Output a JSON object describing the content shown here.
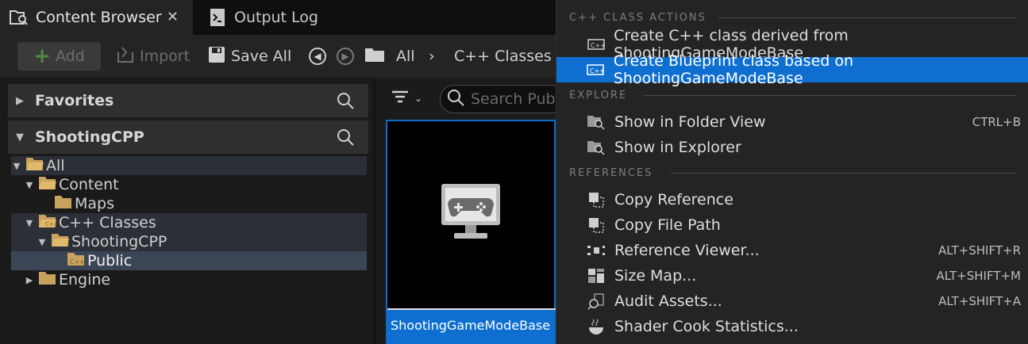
{
  "tabs": [
    {
      "label": "Content Browser",
      "icon": "content-browser-icon",
      "active": true
    },
    {
      "label": "Output Log",
      "icon": "output-log-icon",
      "active": false
    }
  ],
  "toolbar": {
    "add_label": "Add",
    "import_label": "Import",
    "save_all_label": "Save All",
    "breadcrumb": [
      "All",
      "C++ Classes"
    ]
  },
  "sidebar": {
    "favorites_label": "Favorites",
    "project_label": "ShootingCPP",
    "tree": [
      {
        "label": "All",
        "depth": 0,
        "expanded": true
      },
      {
        "label": "Content",
        "depth": 1,
        "expanded": true
      },
      {
        "label": "Maps",
        "depth": 2,
        "expanded": false
      },
      {
        "label": "C++ Classes",
        "depth": 1,
        "expanded": true
      },
      {
        "label": "ShootingCPP",
        "depth": 2,
        "expanded": true
      },
      {
        "label": "Public",
        "depth": 3,
        "selected": true
      },
      {
        "label": "Engine",
        "depth": 1,
        "expanded": false
      }
    ]
  },
  "assets": {
    "search_placeholder": "Search Public",
    "items": [
      {
        "name": "ShootingGameModeBase",
        "icon": "game-mode-icon"
      }
    ]
  },
  "context_menu": {
    "sections": [
      {
        "title": "C++ CLASS ACTIONS",
        "items": [
          {
            "label": "Create C++ class derived from ShootingGameModeBase",
            "icon": "cpp-class-icon",
            "shortcut": ""
          },
          {
            "label": "Create Blueprint class based on ShootingGameModeBase",
            "icon": "cpp-class-icon",
            "shortcut": "",
            "highlighted": true
          }
        ]
      },
      {
        "title": "EXPLORE",
        "items": [
          {
            "label": "Show in Folder View",
            "icon": "folder-search-icon",
            "shortcut": "CTRL+B"
          },
          {
            "label": "Show in Explorer",
            "icon": "folder-search-icon",
            "shortcut": ""
          }
        ]
      },
      {
        "title": "REFERENCES",
        "items": [
          {
            "label": "Copy Reference",
            "icon": "copy-icon",
            "shortcut": ""
          },
          {
            "label": "Copy File Path",
            "icon": "copy-icon",
            "shortcut": ""
          },
          {
            "label": "Reference Viewer...",
            "icon": "reference-viewer-icon",
            "shortcut": "ALT+SHIFT+R"
          },
          {
            "label": "Size Map...",
            "icon": "size-map-icon",
            "shortcut": "ALT+SHIFT+M"
          },
          {
            "label": "Audit Assets...",
            "icon": "audit-icon",
            "shortcut": "ALT+SHIFT+A"
          },
          {
            "label": "Shader Cook Statistics...",
            "icon": "shader-icon",
            "shortcut": ""
          }
        ]
      }
    ]
  },
  "colors": {
    "accent": "#0e6fd1",
    "folder": "#c9a25d",
    "add_green": "#4f8a3e"
  }
}
